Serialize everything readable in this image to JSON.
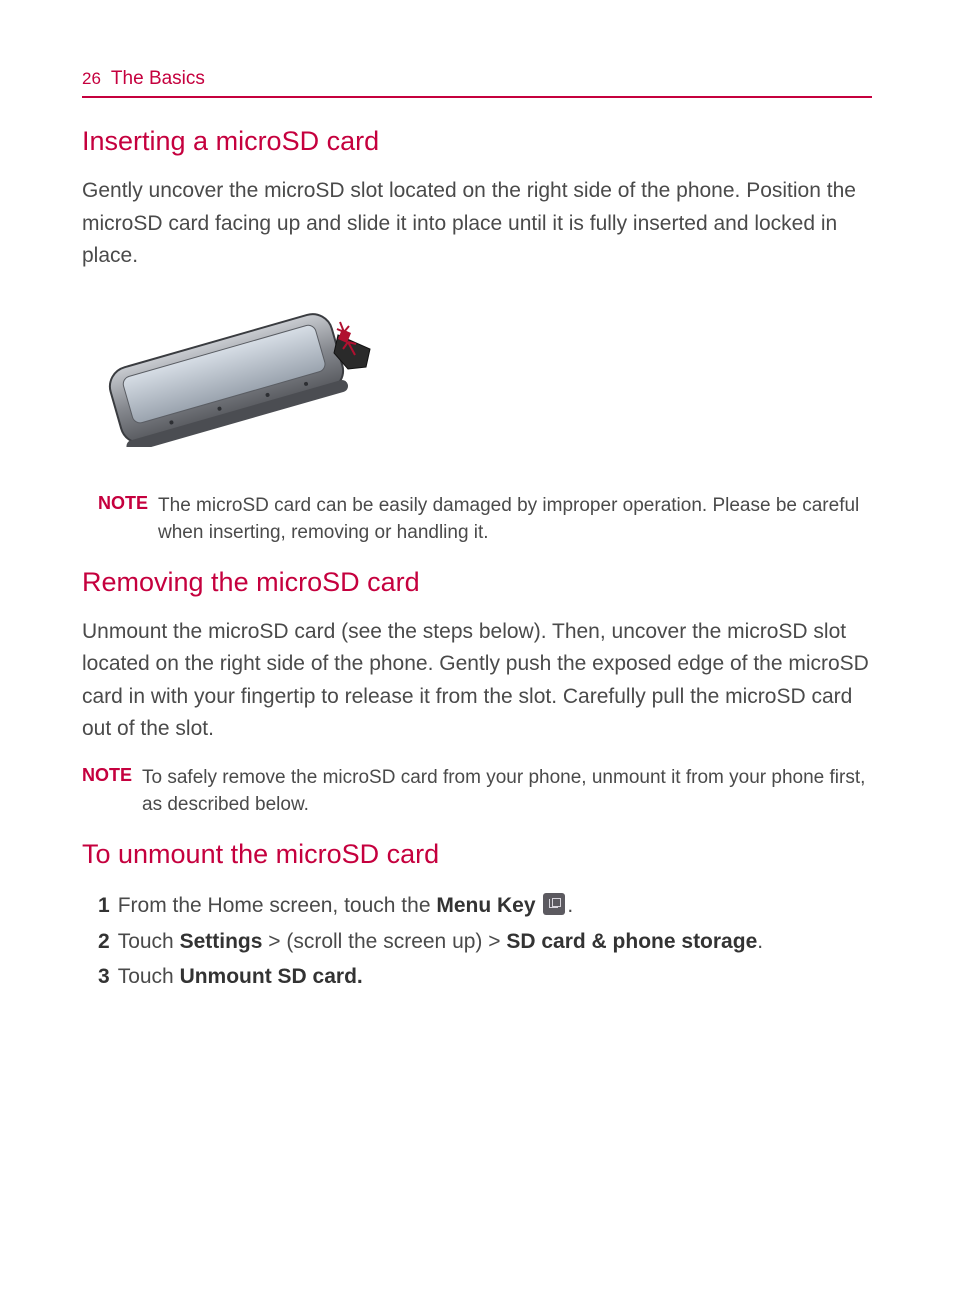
{
  "header": {
    "page_number": "26",
    "section": "The Basics"
  },
  "sections": {
    "insert": {
      "heading": "Inserting a microSD card",
      "body": "Gently uncover the microSD slot located on the right side of the phone. Position the microSD card facing up and slide it into place until it is fully inserted and locked in place.",
      "note_label": "NOTE",
      "note_body": "The microSD card can be easily damaged by improper operation. Please be careful when inserting, removing or handling it."
    },
    "remove": {
      "heading": "Removing the microSD card",
      "body": "Unmount the microSD card (see the steps below). Then, uncover the microSD slot located on the right side of the phone. Gently push the exposed edge of the microSD card in with your fingertip to release it from the slot. Carefully pull the microSD card out of the slot.",
      "note_label": "NOTE",
      "note_body": "To safely remove the microSD card from your phone, unmount it from your phone first, as described below."
    },
    "unmount": {
      "heading": "To unmount the microSD card",
      "steps": {
        "s1": {
          "num": "1",
          "pre": "From the Home screen, touch the ",
          "b1": "Menu Key ",
          "post": "."
        },
        "s2": {
          "num": "2",
          "pre": "Touch ",
          "b1": "Settings",
          "mid": " > (scroll the screen up) > ",
          "b2": "SD card & phone storage",
          "post": "."
        },
        "s3": {
          "num": "3",
          "pre": "Touch ",
          "b1": "Unmount SD card."
        }
      }
    }
  }
}
